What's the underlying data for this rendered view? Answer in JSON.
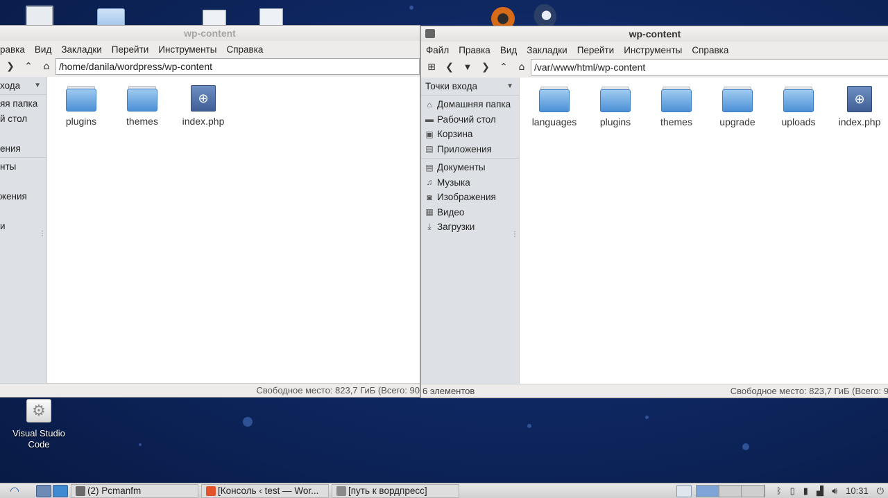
{
  "desktop": {
    "icons": [
      {
        "name": "Visual Studio Code"
      }
    ]
  },
  "left_window": {
    "title": "wp-content",
    "menu": [
      "равка",
      "Вид",
      "Закладки",
      "Перейти",
      "Инструменты",
      "Справка"
    ],
    "path": "/home/danila/wordpress/wp-content",
    "sidebar": {
      "header": "хода",
      "group1": [
        "яя папка",
        "й стол",
        "",
        "ения"
      ],
      "group2": [
        "нты",
        "",
        "жения",
        "",
        "и"
      ]
    },
    "files": [
      {
        "name": "plugins",
        "type": "folder"
      },
      {
        "name": "themes",
        "type": "folder"
      },
      {
        "name": "index.php",
        "type": "php"
      }
    ],
    "status": {
      "left": "",
      "right": "Свободное место: 823,7 ГиБ (Всего: 90"
    }
  },
  "right_window": {
    "title": "wp-content",
    "menu": [
      "Файл",
      "Правка",
      "Вид",
      "Закладки",
      "Перейти",
      "Инструменты",
      "Справка"
    ],
    "path": "/var/www/html/wp-content",
    "sidebar": {
      "header": "Точки входа",
      "group1": [
        {
          "label": "Домашняя папка",
          "icon": "home-icon",
          "glyph": "⌂"
        },
        {
          "label": "Рабочий стол",
          "icon": "desktop-icon",
          "glyph": "▬"
        },
        {
          "label": "Корзина",
          "icon": "trash-icon",
          "glyph": "▣"
        },
        {
          "label": "Приложения",
          "icon": "applications-icon",
          "glyph": "▤"
        }
      ],
      "group2": [
        {
          "label": "Документы",
          "icon": "documents-icon",
          "glyph": "▤"
        },
        {
          "label": "Музыка",
          "icon": "music-icon",
          "glyph": "♫"
        },
        {
          "label": "Изображения",
          "icon": "pictures-icon",
          "glyph": "◙"
        },
        {
          "label": "Видео",
          "icon": "video-icon",
          "glyph": "▦"
        },
        {
          "label": "Загрузки",
          "icon": "downloads-icon",
          "glyph": "⤓"
        }
      ]
    },
    "files": [
      {
        "name": "languages",
        "type": "folder"
      },
      {
        "name": "plugins",
        "type": "folder"
      },
      {
        "name": "themes",
        "type": "folder"
      },
      {
        "name": "upgrade",
        "type": "folder"
      },
      {
        "name": "uploads",
        "type": "folder"
      },
      {
        "name": "index.php",
        "type": "php"
      }
    ],
    "status": {
      "left": "6 элементов",
      "right": "Свободное место: 823,7 ГиБ (Всего: 9"
    }
  },
  "taskbar": {
    "tasks": [
      {
        "label": "(2) Pcmanfm",
        "icon": "folder-icon",
        "color": "#6a6a6a"
      },
      {
        "label": "[Консоль ‹ test — Wor...",
        "icon": "browser-icon",
        "color": "#e2522b"
      },
      {
        "label": "[путь к вордпресс]",
        "icon": "document-icon",
        "color": "#8a8a8a"
      }
    ],
    "clock": "10:31"
  }
}
